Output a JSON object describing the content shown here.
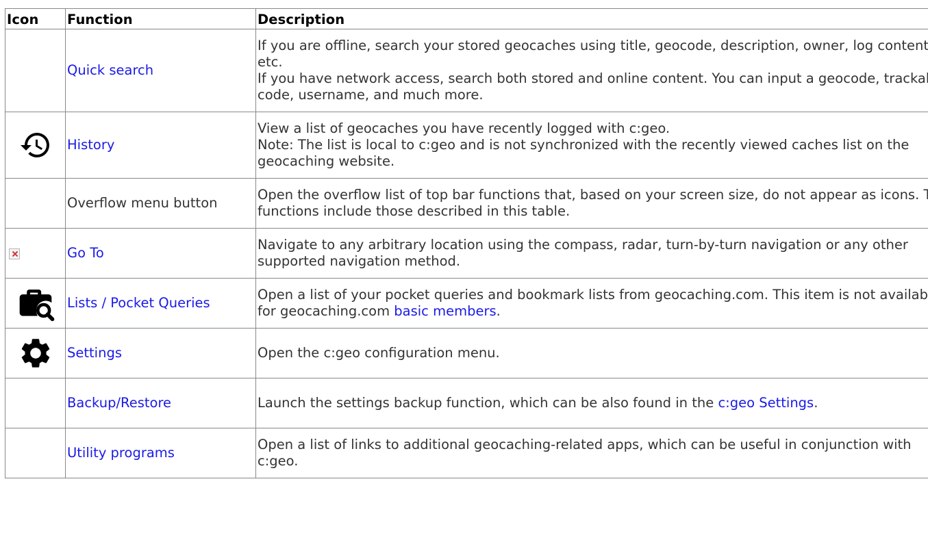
{
  "table": {
    "headers": {
      "icon": "Icon",
      "function": "Function",
      "description": "Description"
    },
    "rows": [
      {
        "function": "Quick search",
        "description_1": "If you are offline, search your stored geocaches using title, geocode, description, owner, log content, etc.",
        "description_2": "If you have network access, search both stored and online content. You can input a geocode, trackable code, username, and much more."
      },
      {
        "icon": "history-icon",
        "function": "History",
        "description_1": "View a list of geocaches you have recently logged with c:geo.",
        "description_2": "Note: The list is local to c:geo and is not synchronized with the recently viewed caches list on the geocaching website."
      },
      {
        "function": "Overflow menu button",
        "description": "Open the overflow list of top bar functions that, based on your screen size, do not appear as icons. The functions include those described in this table."
      },
      {
        "icon": "broken-image-icon",
        "function": "Go To",
        "description": "Navigate to any arbitrary location using the compass, radar, turn-by-turn navigation or any other supported navigation method."
      },
      {
        "icon": "briefcase-search-icon",
        "function": "Lists / Pocket Queries",
        "description_before": "Open a list of your pocket queries and bookmark lists from geocaching.com. This item is not available for geocaching.com ",
        "description_link": "basic members",
        "description_after": "."
      },
      {
        "icon": "gear-icon",
        "function": "Settings",
        "description": "Open the c:geo configuration menu."
      },
      {
        "function": "Backup/Restore",
        "description_before": "Launch the settings backup function, which can be also found in the ",
        "description_link": "c:geo Settings",
        "description_after": "."
      },
      {
        "function": "Utility programs",
        "description": "Open a list of links to additional geocaching-related apps, which can be useful in conjunction with c:geo."
      }
    ]
  },
  "colors": {
    "link": "#1a1ae6",
    "text": "#333333",
    "border": "#888888"
  }
}
